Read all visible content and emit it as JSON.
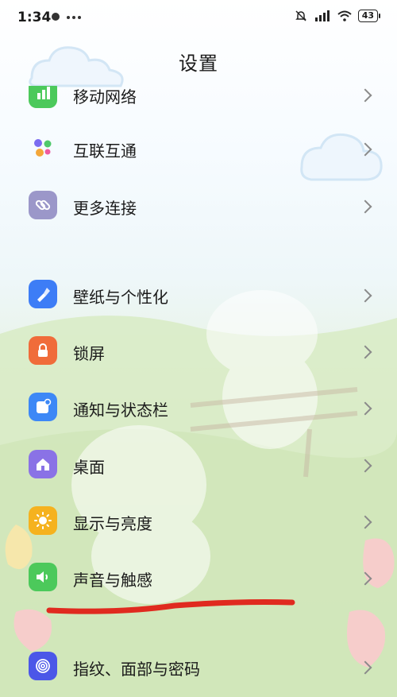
{
  "status_bar": {
    "time": "1:34",
    "battery": "43"
  },
  "page": {
    "title": "设置"
  },
  "items": [
    {
      "label": "移动网络",
      "icon": "cellular-icon",
      "color": "#4cc95b"
    },
    {
      "label": "互联互通",
      "icon": "interconnect-icon",
      "color": "#ffffff"
    },
    {
      "label": "更多连接",
      "icon": "link-icon",
      "color": "#9b97c9"
    },
    {
      "label": "壁纸与个性化",
      "icon": "brush-icon",
      "color": "#3d7df6"
    },
    {
      "label": "锁屏",
      "icon": "lock-icon",
      "color": "#f06c3a"
    },
    {
      "label": "通知与状态栏",
      "icon": "notification-icon",
      "color": "#3d88f6"
    },
    {
      "label": "桌面",
      "icon": "home-icon",
      "color": "#8a72e6"
    },
    {
      "label": "显示与亮度",
      "icon": "sun-icon",
      "color": "#f5b21f"
    },
    {
      "label": "声音与触感",
      "icon": "speaker-icon",
      "color": "#4cc95b"
    },
    {
      "label": "指纹、面部与密码",
      "icon": "fingerprint-icon",
      "color": "#4b57e8"
    }
  ],
  "annotation_color": "#e02a1f"
}
